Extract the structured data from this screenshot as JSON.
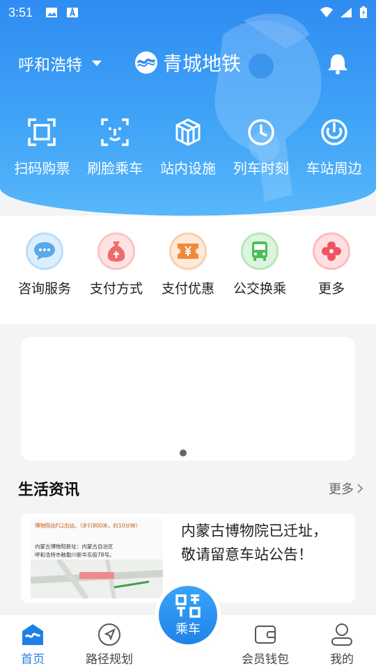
{
  "status_bar": {
    "time": "3:51"
  },
  "header": {
    "city": "呼和浩特",
    "brand": "青城地铁",
    "quick_actions": [
      {
        "label": "扫码购票",
        "icon": "scan-icon"
      },
      {
        "label": "刷脸乘车",
        "icon": "face-scan-icon"
      },
      {
        "label": "站内设施",
        "icon": "facilities-icon"
      },
      {
        "label": "列车时刻",
        "icon": "clock-icon"
      },
      {
        "label": "车站周边",
        "icon": "nearby-icon"
      }
    ]
  },
  "services": [
    {
      "label": "咨询服务",
      "icon": "chat-bubble-icon",
      "color": "#5aa9ea"
    },
    {
      "label": "支付方式",
      "icon": "money-bag-icon",
      "color": "#ef6a6a"
    },
    {
      "label": "支付优惠",
      "icon": "coupon-icon",
      "color": "#f08a3c"
    },
    {
      "label": "公交换乘",
      "icon": "bus-icon",
      "color": "#4cbf5a"
    },
    {
      "label": "更多",
      "icon": "more-flower-icon",
      "color": "#ee5560"
    }
  ],
  "news": {
    "title": "生活资讯",
    "more": "更多",
    "item": {
      "text_line1": "内蒙古博物院已迁址，",
      "text_line2": "敬请留意车站公告！",
      "thumb_line1": "博物院站F口出站。（步行800米，约10分钟）",
      "thumb_line2": "内蒙古博物院新址：内蒙古自治区",
      "thumb_line3": "呼和浩特市敕勒川新华东街78号。"
    }
  },
  "bottom_nav": {
    "home": "首页",
    "route": "路径规划",
    "ride": "乘车",
    "wallet": "会员钱包",
    "mine": "我的"
  },
  "colors": {
    "primary": "#2f8cf2",
    "active": "#1f7fe8"
  }
}
